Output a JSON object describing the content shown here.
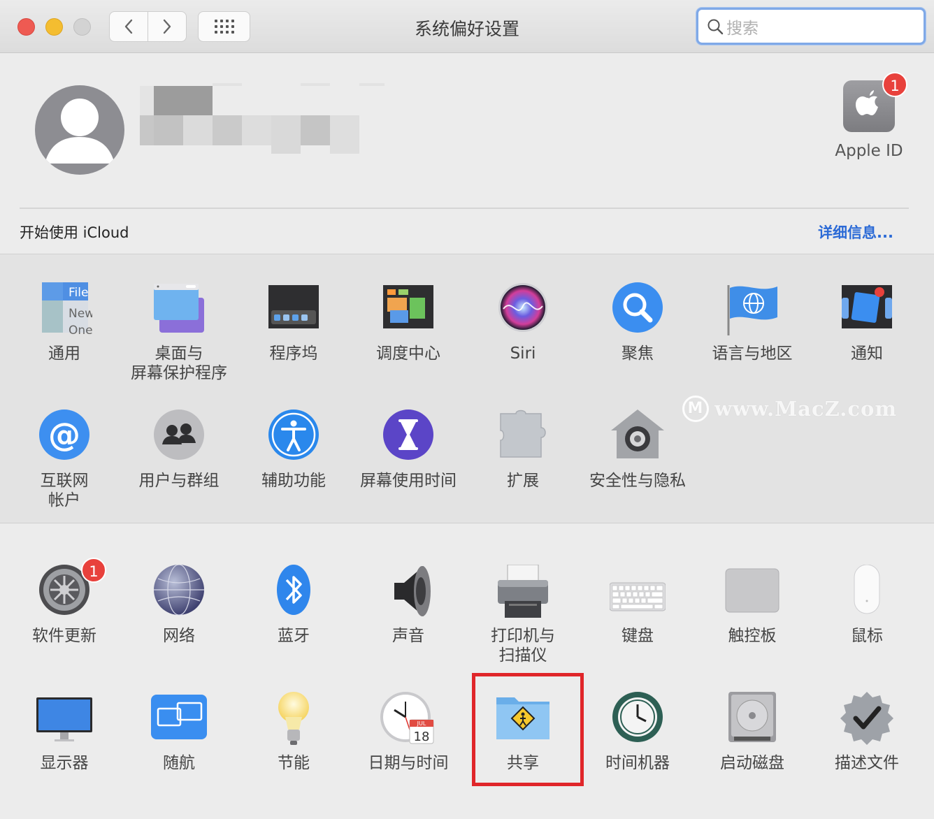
{
  "window": {
    "title": "系统偏好设置"
  },
  "search": {
    "placeholder": "搜索"
  },
  "account": {
    "apple_id_label": "Apple ID",
    "apple_id_badge": "1",
    "icloud_prompt": "开始使用 iCloud",
    "details_link": "详细信息..."
  },
  "sections": {
    "personal": [
      {
        "name": "general",
        "label": "通用"
      },
      {
        "name": "desktop-screensaver",
        "label": "桌面与\n屏幕保护程序"
      },
      {
        "name": "dock",
        "label": "程序坞"
      },
      {
        "name": "mission-control",
        "label": "调度中心"
      },
      {
        "name": "siri",
        "label": "Siri"
      },
      {
        "name": "spotlight",
        "label": "聚焦"
      },
      {
        "name": "language-region",
        "label": "语言与地区"
      },
      {
        "name": "notifications",
        "label": "通知"
      },
      {
        "name": "internet-accounts",
        "label": "互联网\n帐户"
      },
      {
        "name": "users-groups",
        "label": "用户与群组"
      },
      {
        "name": "accessibility",
        "label": "辅助功能"
      },
      {
        "name": "screen-time",
        "label": "屏幕使用时间"
      },
      {
        "name": "extensions",
        "label": "扩展"
      },
      {
        "name": "security-privacy",
        "label": "安全性与隐私"
      }
    ],
    "hardware": [
      {
        "name": "software-update",
        "label": "软件更新",
        "badge": "1"
      },
      {
        "name": "network",
        "label": "网络"
      },
      {
        "name": "bluetooth",
        "label": "蓝牙"
      },
      {
        "name": "sound",
        "label": "声音"
      },
      {
        "name": "printers-scanners",
        "label": "打印机与\n扫描仪"
      },
      {
        "name": "keyboard",
        "label": "键盘"
      },
      {
        "name": "trackpad",
        "label": "触控板"
      },
      {
        "name": "mouse",
        "label": "鼠标"
      },
      {
        "name": "displays",
        "label": "显示器"
      },
      {
        "name": "sidecar",
        "label": "随航"
      },
      {
        "name": "energy-saver",
        "label": "节能"
      },
      {
        "name": "date-time",
        "label": "日期与时间"
      },
      {
        "name": "sharing",
        "label": "共享"
      },
      {
        "name": "time-machine",
        "label": "时间机器"
      },
      {
        "name": "startup-disk",
        "label": "启动磁盘"
      },
      {
        "name": "profiles",
        "label": "描述文件"
      }
    ]
  },
  "icon_text": {
    "general_file": "File",
    "general_new": "New",
    "general_one": "One",
    "calendar_month": "JUL",
    "calendar_day": "18"
  },
  "watermark": {
    "logo": "M",
    "text": "www.MacZ.com"
  },
  "colors": {
    "accent": "#2b6ad6",
    "highlight": "#e0262a",
    "badge": "#e8413c"
  }
}
